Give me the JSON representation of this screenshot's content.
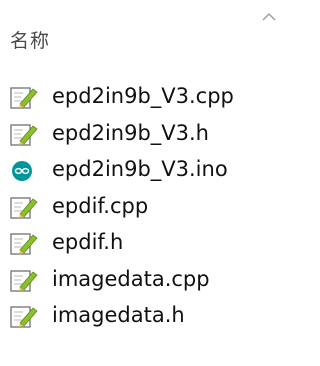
{
  "header": {
    "column_label": "名称",
    "sort_icon": "chevron-up-icon"
  },
  "files": [
    {
      "name": "epd2in9b_V3.cpp",
      "icon": "text-file-icon"
    },
    {
      "name": "epd2in9b_V3.h",
      "icon": "text-file-icon"
    },
    {
      "name": "epd2in9b_V3.ino",
      "icon": "arduino-file-icon"
    },
    {
      "name": "epdif.cpp",
      "icon": "text-file-icon"
    },
    {
      "name": "epdif.h",
      "icon": "text-file-icon"
    },
    {
      "name": "imagedata.cpp",
      "icon": "text-file-icon"
    },
    {
      "name": "imagedata.h",
      "icon": "text-file-icon"
    }
  ],
  "colors": {
    "arduino_teal": "#00979c",
    "file_page": "#ffffff",
    "file_border": "#7a7a7a",
    "pencil_green": "#8cbf2f",
    "pencil_tip": "#e8c25a"
  }
}
